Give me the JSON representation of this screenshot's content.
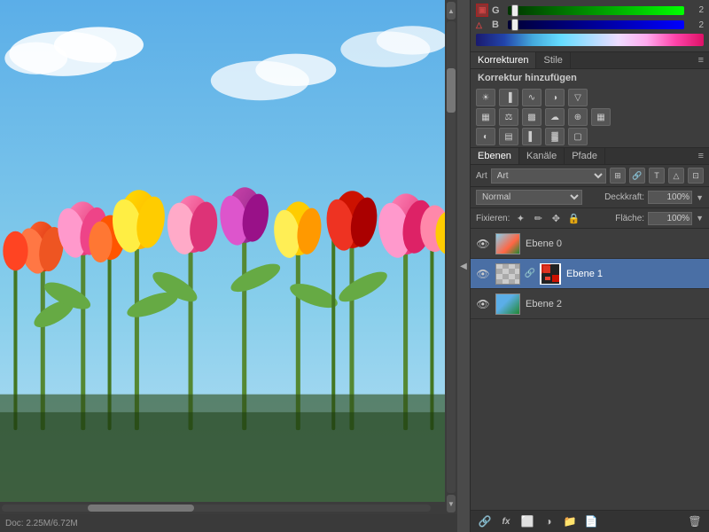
{
  "canvas": {
    "title": "Tulips image"
  },
  "color_sliders": {
    "g_label": "G",
    "g_value": "2",
    "b_label": "B",
    "b_value": "2"
  },
  "corrections": {
    "tab1": "Korrekturen",
    "tab2": "Stile",
    "title": "Korrektur hinzufügen",
    "menu_icon": "≡"
  },
  "layers": {
    "tab1": "Ebenen",
    "tab2": "Kanäle",
    "tab3": "Pfade",
    "menu_icon": "≡",
    "kind_label": "Art",
    "blend_mode": "Normal",
    "opacity_label": "Deckkraft:",
    "opacity_value": "100%",
    "fill_label": "Fläche:",
    "fill_value": "100%",
    "fix_label": "Fixieren:",
    "items": [
      {
        "name": "Ebene 0",
        "selected": false,
        "visible": true,
        "has_mask": false
      },
      {
        "name": "Ebene 1",
        "selected": true,
        "visible": true,
        "has_mask": true
      },
      {
        "name": "Ebene 2",
        "selected": false,
        "visible": true,
        "has_mask": false
      }
    ],
    "bottom_icons": [
      "🔗",
      "fx",
      "🔲",
      "⊕",
      "📁",
      "🗑"
    ]
  }
}
